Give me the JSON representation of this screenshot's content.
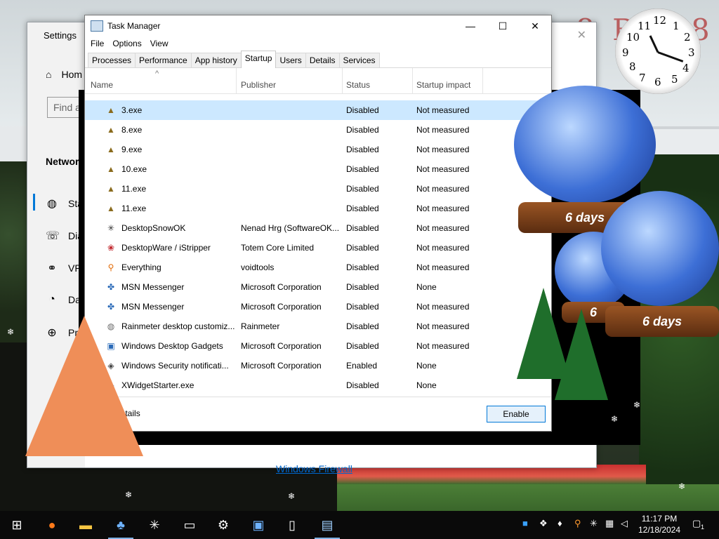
{
  "settings": {
    "title": "Settings",
    "home": "Hom",
    "find_placeholder": "Find a",
    "section": "Network",
    "items": [
      {
        "label": "Sta",
        "icon": "globe-icon"
      },
      {
        "label": "Dia",
        "icon": "dialup-icon"
      },
      {
        "label": "VP",
        "icon": "vpn-icon"
      },
      {
        "label": "Da",
        "icon": "data-usage-icon"
      },
      {
        "label": "Pro",
        "icon": "proxy-icon"
      }
    ],
    "firewall_link": "Windows Firewall"
  },
  "taskmanager": {
    "title": "Task Manager",
    "menu": [
      "File",
      "Options",
      "View"
    ],
    "tabs": [
      "Processes",
      "Performance",
      "App history",
      "Startup",
      "Users",
      "Details",
      "Services"
    ],
    "active_tab": "Startup",
    "columns": {
      "name": "Name",
      "publisher": "Publisher",
      "status": "Status",
      "impact": "Startup impact"
    },
    "rows": [
      {
        "icon": "tree-icon",
        "name": "3.exe",
        "publisher": "",
        "status": "Disabled",
        "impact": "Not measured"
      },
      {
        "icon": "tree-icon",
        "name": "8.exe",
        "publisher": "",
        "status": "Disabled",
        "impact": "Not measured"
      },
      {
        "icon": "tree-icon",
        "name": "9.exe",
        "publisher": "",
        "status": "Disabled",
        "impact": "Not measured"
      },
      {
        "icon": "tree-icon",
        "name": "10.exe",
        "publisher": "",
        "status": "Disabled",
        "impact": "Not measured"
      },
      {
        "icon": "tree-icon",
        "name": "11.exe",
        "publisher": "",
        "status": "Disabled",
        "impact": "Not measured"
      },
      {
        "icon": "tree-icon",
        "name": "11.exe",
        "publisher": "",
        "status": "Disabled",
        "impact": "Not measured"
      },
      {
        "icon": "snowflake-icon",
        "name": "DesktopSnowOK",
        "publisher": "Nenad Hrg (SoftwareOK...",
        "status": "Disabled",
        "impact": "Not measured"
      },
      {
        "icon": "istripper-icon",
        "name": "DesktopWare / iStripper",
        "publisher": "Totem Core Limited",
        "status": "Disabled",
        "impact": "Not measured"
      },
      {
        "icon": "search-icon",
        "name": "Everything",
        "publisher": "voidtools",
        "status": "Disabled",
        "impact": "Not measured"
      },
      {
        "icon": "msn-icon",
        "name": "MSN Messenger",
        "publisher": "Microsoft Corporation",
        "status": "Disabled",
        "impact": "None"
      },
      {
        "icon": "msn-icon",
        "name": "MSN Messenger",
        "publisher": "Microsoft Corporation",
        "status": "Disabled",
        "impact": "Not measured"
      },
      {
        "icon": "rainmeter-icon",
        "name": "Rainmeter desktop customiz...",
        "publisher": "Rainmeter",
        "status": "Disabled",
        "impact": "Not measured"
      },
      {
        "icon": "gadgets-icon",
        "name": "Windows Desktop Gadgets",
        "publisher": "Microsoft Corporation",
        "status": "Disabled",
        "impact": "Not measured"
      },
      {
        "icon": "shield-icon",
        "name": "Windows Security notificati...",
        "publisher": "Microsoft Corporation",
        "status": "Enabled",
        "impact": "None"
      },
      {
        "icon": "xwidget-icon",
        "name": "XWidgetStarter.exe",
        "publisher": "",
        "status": "Disabled",
        "impact": "None"
      }
    ],
    "fewer_details": "Fewer details",
    "fewer_details_visible": "er details",
    "enable_button": "Enable"
  },
  "decorations": {
    "banner_text": "8 B A  8",
    "globe_label_1": "6 days",
    "globe_label_2": "6 days",
    "globe_label_3": "6",
    "clock_numbers": [
      "12",
      "1",
      "2",
      "3",
      "4",
      "5",
      "6",
      "7",
      "8",
      "9",
      "10",
      "11"
    ]
  },
  "taskbar": {
    "apps": [
      "start-icon",
      "firefox-icon",
      "file-explorer-icon",
      "xmas-app-icon",
      "snowflake-app-icon",
      "terminal-icon",
      "settings-gear-icon",
      "monitor-app-icon",
      "document-icon",
      "task-manager-icon"
    ],
    "time": "11:17 PM",
    "date": "12/18/2024",
    "notification_count": "1"
  }
}
